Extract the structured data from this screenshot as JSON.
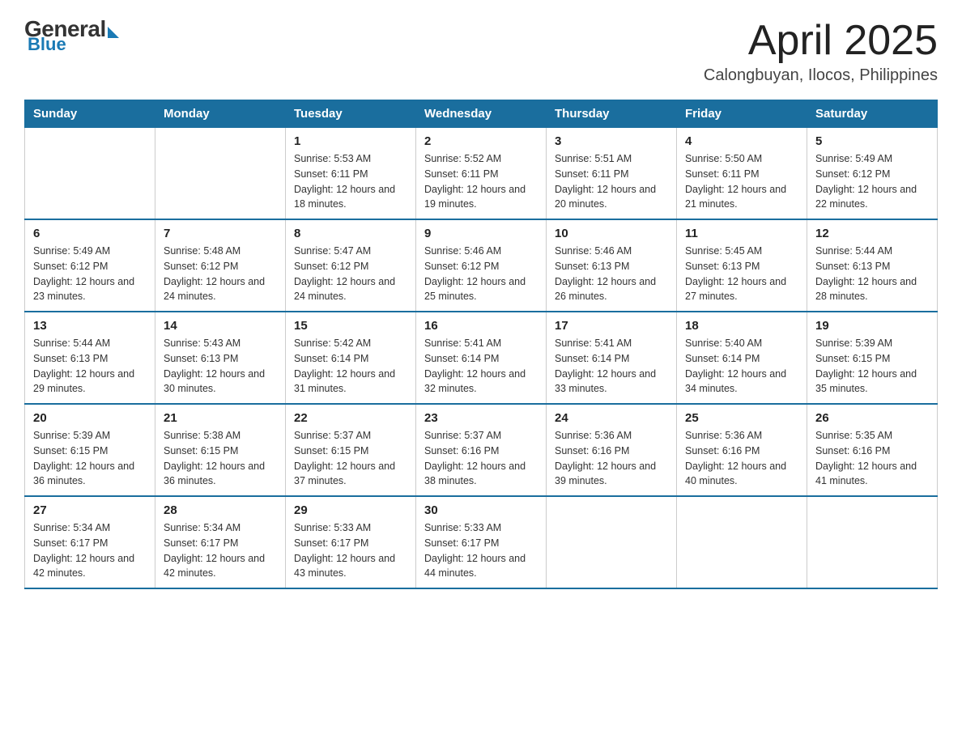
{
  "header": {
    "logo_general": "General",
    "logo_blue": "Blue",
    "month": "April 2025",
    "location": "Calongbuyan, Ilocos, Philippines"
  },
  "days_of_week": [
    "Sunday",
    "Monday",
    "Tuesday",
    "Wednesday",
    "Thursday",
    "Friday",
    "Saturday"
  ],
  "weeks": [
    [
      {
        "day": "",
        "sunrise": "",
        "sunset": "",
        "daylight": ""
      },
      {
        "day": "",
        "sunrise": "",
        "sunset": "",
        "daylight": ""
      },
      {
        "day": "1",
        "sunrise": "Sunrise: 5:53 AM",
        "sunset": "Sunset: 6:11 PM",
        "daylight": "Daylight: 12 hours and 18 minutes."
      },
      {
        "day": "2",
        "sunrise": "Sunrise: 5:52 AM",
        "sunset": "Sunset: 6:11 PM",
        "daylight": "Daylight: 12 hours and 19 minutes."
      },
      {
        "day": "3",
        "sunrise": "Sunrise: 5:51 AM",
        "sunset": "Sunset: 6:11 PM",
        "daylight": "Daylight: 12 hours and 20 minutes."
      },
      {
        "day": "4",
        "sunrise": "Sunrise: 5:50 AM",
        "sunset": "Sunset: 6:11 PM",
        "daylight": "Daylight: 12 hours and 21 minutes."
      },
      {
        "day": "5",
        "sunrise": "Sunrise: 5:49 AM",
        "sunset": "Sunset: 6:12 PM",
        "daylight": "Daylight: 12 hours and 22 minutes."
      }
    ],
    [
      {
        "day": "6",
        "sunrise": "Sunrise: 5:49 AM",
        "sunset": "Sunset: 6:12 PM",
        "daylight": "Daylight: 12 hours and 23 minutes."
      },
      {
        "day": "7",
        "sunrise": "Sunrise: 5:48 AM",
        "sunset": "Sunset: 6:12 PM",
        "daylight": "Daylight: 12 hours and 24 minutes."
      },
      {
        "day": "8",
        "sunrise": "Sunrise: 5:47 AM",
        "sunset": "Sunset: 6:12 PM",
        "daylight": "Daylight: 12 hours and 24 minutes."
      },
      {
        "day": "9",
        "sunrise": "Sunrise: 5:46 AM",
        "sunset": "Sunset: 6:12 PM",
        "daylight": "Daylight: 12 hours and 25 minutes."
      },
      {
        "day": "10",
        "sunrise": "Sunrise: 5:46 AM",
        "sunset": "Sunset: 6:13 PM",
        "daylight": "Daylight: 12 hours and 26 minutes."
      },
      {
        "day": "11",
        "sunrise": "Sunrise: 5:45 AM",
        "sunset": "Sunset: 6:13 PM",
        "daylight": "Daylight: 12 hours and 27 minutes."
      },
      {
        "day": "12",
        "sunrise": "Sunrise: 5:44 AM",
        "sunset": "Sunset: 6:13 PM",
        "daylight": "Daylight: 12 hours and 28 minutes."
      }
    ],
    [
      {
        "day": "13",
        "sunrise": "Sunrise: 5:44 AM",
        "sunset": "Sunset: 6:13 PM",
        "daylight": "Daylight: 12 hours and 29 minutes."
      },
      {
        "day": "14",
        "sunrise": "Sunrise: 5:43 AM",
        "sunset": "Sunset: 6:13 PM",
        "daylight": "Daylight: 12 hours and 30 minutes."
      },
      {
        "day": "15",
        "sunrise": "Sunrise: 5:42 AM",
        "sunset": "Sunset: 6:14 PM",
        "daylight": "Daylight: 12 hours and 31 minutes."
      },
      {
        "day": "16",
        "sunrise": "Sunrise: 5:41 AM",
        "sunset": "Sunset: 6:14 PM",
        "daylight": "Daylight: 12 hours and 32 minutes."
      },
      {
        "day": "17",
        "sunrise": "Sunrise: 5:41 AM",
        "sunset": "Sunset: 6:14 PM",
        "daylight": "Daylight: 12 hours and 33 minutes."
      },
      {
        "day": "18",
        "sunrise": "Sunrise: 5:40 AM",
        "sunset": "Sunset: 6:14 PM",
        "daylight": "Daylight: 12 hours and 34 minutes."
      },
      {
        "day": "19",
        "sunrise": "Sunrise: 5:39 AM",
        "sunset": "Sunset: 6:15 PM",
        "daylight": "Daylight: 12 hours and 35 minutes."
      }
    ],
    [
      {
        "day": "20",
        "sunrise": "Sunrise: 5:39 AM",
        "sunset": "Sunset: 6:15 PM",
        "daylight": "Daylight: 12 hours and 36 minutes."
      },
      {
        "day": "21",
        "sunrise": "Sunrise: 5:38 AM",
        "sunset": "Sunset: 6:15 PM",
        "daylight": "Daylight: 12 hours and 36 minutes."
      },
      {
        "day": "22",
        "sunrise": "Sunrise: 5:37 AM",
        "sunset": "Sunset: 6:15 PM",
        "daylight": "Daylight: 12 hours and 37 minutes."
      },
      {
        "day": "23",
        "sunrise": "Sunrise: 5:37 AM",
        "sunset": "Sunset: 6:16 PM",
        "daylight": "Daylight: 12 hours and 38 minutes."
      },
      {
        "day": "24",
        "sunrise": "Sunrise: 5:36 AM",
        "sunset": "Sunset: 6:16 PM",
        "daylight": "Daylight: 12 hours and 39 minutes."
      },
      {
        "day": "25",
        "sunrise": "Sunrise: 5:36 AM",
        "sunset": "Sunset: 6:16 PM",
        "daylight": "Daylight: 12 hours and 40 minutes."
      },
      {
        "day": "26",
        "sunrise": "Sunrise: 5:35 AM",
        "sunset": "Sunset: 6:16 PM",
        "daylight": "Daylight: 12 hours and 41 minutes."
      }
    ],
    [
      {
        "day": "27",
        "sunrise": "Sunrise: 5:34 AM",
        "sunset": "Sunset: 6:17 PM",
        "daylight": "Daylight: 12 hours and 42 minutes."
      },
      {
        "day": "28",
        "sunrise": "Sunrise: 5:34 AM",
        "sunset": "Sunset: 6:17 PM",
        "daylight": "Daylight: 12 hours and 42 minutes."
      },
      {
        "day": "29",
        "sunrise": "Sunrise: 5:33 AM",
        "sunset": "Sunset: 6:17 PM",
        "daylight": "Daylight: 12 hours and 43 minutes."
      },
      {
        "day": "30",
        "sunrise": "Sunrise: 5:33 AM",
        "sunset": "Sunset: 6:17 PM",
        "daylight": "Daylight: 12 hours and 44 minutes."
      },
      {
        "day": "",
        "sunrise": "",
        "sunset": "",
        "daylight": ""
      },
      {
        "day": "",
        "sunrise": "",
        "sunset": "",
        "daylight": ""
      },
      {
        "day": "",
        "sunrise": "",
        "sunset": "",
        "daylight": ""
      }
    ]
  ]
}
